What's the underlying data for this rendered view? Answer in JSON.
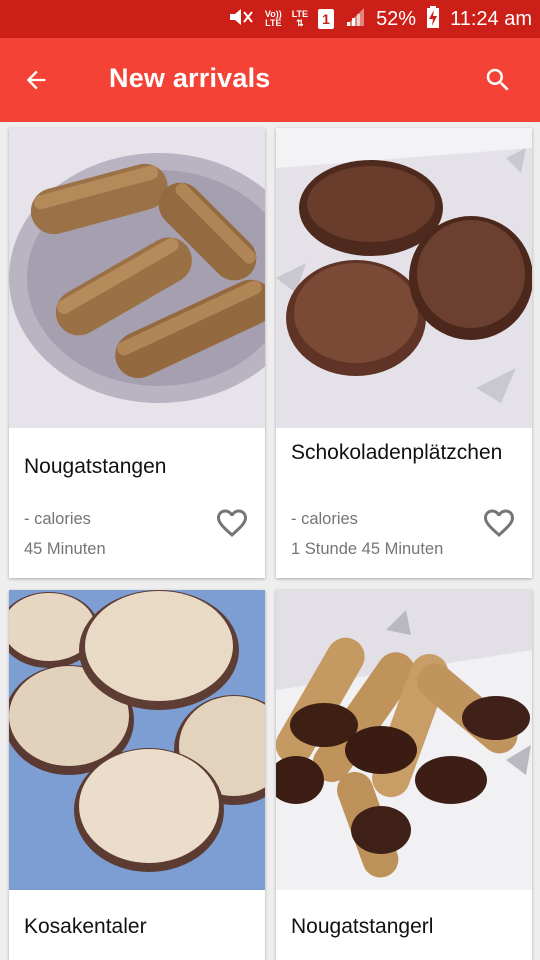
{
  "status_bar": {
    "volte_label_top": "Vo))",
    "volte_label_bottom": "LTE",
    "lte_label": "LTE",
    "sim_number": "1",
    "battery_percent": "52%",
    "time": "11:24 am",
    "icons": [
      "mute-icon",
      "signal-icon",
      "battery-charging-icon"
    ]
  },
  "app_bar": {
    "title": "New arrivals",
    "back_icon": "arrow-back-icon",
    "search_icon": "search-icon",
    "color": "#f44336",
    "status_color": "#cc1f17"
  },
  "recipes": [
    {
      "name": "Nougatstangen",
      "calories": "- calories",
      "time": "45 Minuten"
    },
    {
      "name": "Schokoladenplätzchen",
      "calories": "- calories",
      "time": "1 Stunde 45 Minuten"
    },
    {
      "name": "Kosakentaler"
    },
    {
      "name": "Nougatstangerl"
    }
  ]
}
